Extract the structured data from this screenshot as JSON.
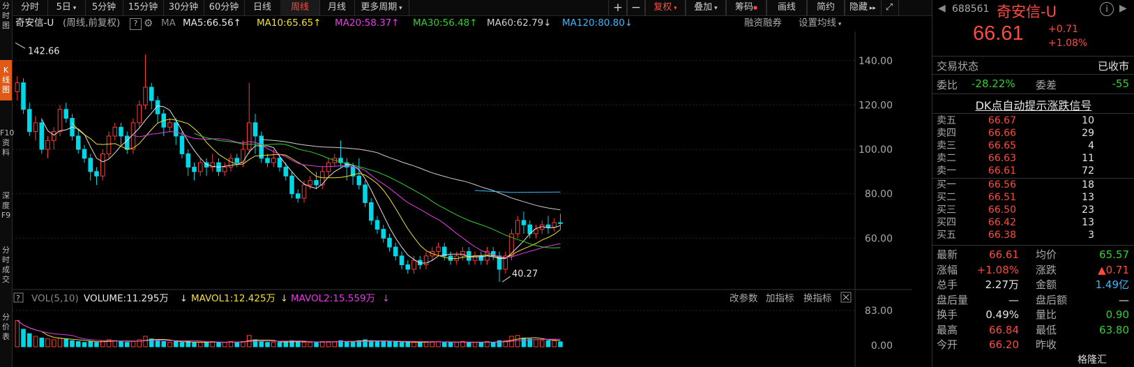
{
  "left_strip": [
    {
      "text": "分\n时\n图",
      "active": false
    },
    {
      "text": "K\n线\n图",
      "active": true
    },
    {
      "text": "F10\n资\n料",
      "active": false
    },
    {
      "text": "深\n度\nF9",
      "active": false
    },
    {
      "text": "分\n时\n成\n交",
      "active": false
    },
    {
      "text": "分\n价\n表",
      "active": false
    }
  ],
  "toolbar": {
    "periods": [
      "分时",
      "5日",
      "5分钟",
      "15分钟",
      "30分钟",
      "60分钟",
      "日线",
      "周线",
      "月线",
      "更多周期"
    ],
    "active_period": "周线",
    "right_buttons": [
      "+",
      "−",
      "复权",
      "叠加",
      "筹码",
      "画线",
      "简约",
      "隐藏"
    ]
  },
  "info": {
    "name": "奇安信-U",
    "mode": "(周线,前复权)",
    "ma_label": "MA",
    "ma": [
      {
        "text": "MA5:66.56",
        "arrow": "↑",
        "color": "#e6e6e6"
      },
      {
        "text": "MA10:65.65",
        "arrow": "↑",
        "color": "#f2e12e"
      },
      {
        "text": "MA20:58.37",
        "arrow": "↑",
        "color": "#e83ae8"
      },
      {
        "text": "MA30:56.48",
        "arrow": "↑",
        "color": "#2fd12f"
      },
      {
        "text": "MA60:62.79",
        "arrow": "↓",
        "color": "#d0d0d0"
      },
      {
        "text": "MA120:80.80",
        "arrow": "↓",
        "color": "#3ab8ff"
      }
    ],
    "right1": "融资融券",
    "right2": "设置均线"
  },
  "chart_data": {
    "type": "candlestick",
    "y_ticks": [
      "140.00",
      "120.00",
      "100.00",
      "80.00",
      "60.00"
    ],
    "ylim": [
      40,
      150
    ],
    "high_label": "142.66",
    "low_label": "40.27",
    "candles": [
      [
        126,
        130,
        122,
        133
      ],
      [
        130,
        118,
        116,
        132
      ],
      [
        118,
        108,
        106,
        121
      ],
      [
        108,
        112,
        104,
        115
      ],
      [
        112,
        100,
        98,
        114
      ],
      [
        100,
        104,
        96,
        106
      ],
      [
        104,
        108,
        100,
        110
      ],
      [
        108,
        118,
        106,
        120
      ],
      [
        118,
        114,
        112,
        121
      ],
      [
        114,
        106,
        104,
        116
      ],
      [
        106,
        100,
        98,
        109
      ],
      [
        100,
        96,
        94,
        102
      ],
      [
        96,
        90,
        86,
        98
      ],
      [
        90,
        88,
        84,
        92
      ],
      [
        88,
        98,
        86,
        100
      ],
      [
        98,
        106,
        96,
        108
      ],
      [
        106,
        110,
        104,
        112
      ],
      [
        110,
        106,
        102,
        112
      ],
      [
        106,
        100,
        98,
        108
      ],
      [
        100,
        112,
        98,
        114
      ],
      [
        112,
        120,
        110,
        122
      ],
      [
        120,
        128,
        118,
        142.66
      ],
      [
        128,
        122,
        118,
        130
      ],
      [
        122,
        116,
        112,
        124
      ],
      [
        116,
        110,
        106,
        118
      ],
      [
        110,
        112,
        108,
        114
      ],
      [
        112,
        106,
        102,
        114
      ],
      [
        106,
        98,
        96,
        108
      ],
      [
        98,
        92,
        88,
        100
      ],
      [
        92,
        90,
        86,
        94
      ],
      [
        90,
        94,
        88,
        96
      ],
      [
        94,
        92,
        88,
        96
      ],
      [
        92,
        94,
        90,
        98
      ],
      [
        94,
        90,
        88,
        96
      ],
      [
        90,
        92,
        88,
        94
      ],
      [
        92,
        96,
        90,
        98
      ],
      [
        96,
        94,
        92,
        98
      ],
      [
        94,
        100,
        92,
        104
      ],
      [
        100,
        112,
        98,
        130
      ],
      [
        112,
        106,
        98,
        116
      ],
      [
        106,
        96,
        94,
        108
      ],
      [
        96,
        94,
        92,
        98
      ],
      [
        94,
        96,
        92,
        100
      ],
      [
        96,
        92,
        90,
        98
      ],
      [
        92,
        88,
        86,
        94
      ],
      [
        88,
        80,
        78,
        90
      ],
      [
        80,
        78,
        76,
        82
      ],
      [
        78,
        84,
        76,
        86
      ],
      [
        84,
        86,
        82,
        88
      ],
      [
        86,
        84,
        82,
        90
      ],
      [
        84,
        90,
        82,
        92
      ],
      [
        90,
        94,
        88,
        96
      ],
      [
        94,
        96,
        92,
        98
      ],
      [
        96,
        94,
        92,
        104
      ],
      [
        94,
        92,
        86,
        96
      ],
      [
        92,
        88,
        84,
        94
      ],
      [
        88,
        84,
        82,
        96
      ],
      [
        84,
        76,
        74,
        86
      ],
      [
        76,
        68,
        66,
        78
      ],
      [
        68,
        64,
        62,
        70
      ],
      [
        64,
        60,
        58,
        66
      ],
      [
        60,
        56,
        54,
        62
      ],
      [
        56,
        52,
        50,
        58
      ],
      [
        52,
        48,
        46,
        54
      ],
      [
        48,
        46,
        44,
        50
      ],
      [
        46,
        50,
        44,
        52
      ],
      [
        50,
        48,
        46,
        52
      ],
      [
        48,
        52,
        46,
        54
      ],
      [
        52,
        54,
        50,
        56
      ],
      [
        54,
        56,
        52,
        58
      ],
      [
        56,
        52,
        50,
        58
      ],
      [
        52,
        50,
        48,
        54
      ],
      [
        50,
        52,
        48,
        54
      ],
      [
        52,
        54,
        50,
        56
      ],
      [
        54,
        50,
        48,
        56
      ],
      [
        50,
        52,
        48,
        54
      ],
      [
        52,
        50,
        48,
        54
      ],
      [
        50,
        54,
        48,
        56
      ],
      [
        54,
        52,
        50,
        56
      ],
      [
        52,
        46,
        40.27,
        54
      ],
      [
        46,
        52,
        44,
        54
      ],
      [
        52,
        62,
        50,
        64
      ],
      [
        62,
        68,
        60,
        70
      ],
      [
        68,
        66,
        62,
        72
      ],
      [
        66,
        62,
        60,
        68
      ],
      [
        62,
        64,
        60,
        66
      ],
      [
        64,
        66,
        62,
        68
      ],
      [
        66,
        65,
        62,
        70
      ],
      [
        65,
        67,
        63,
        69
      ],
      [
        67,
        66.61,
        63.8,
        71
      ]
    ],
    "ma_series": [
      {
        "name": "MA5",
        "color": "#e6e6e6"
      },
      {
        "name": "MA10",
        "color": "#f2e12e"
      },
      {
        "name": "MA20",
        "color": "#e83ae8"
      },
      {
        "name": "MA30",
        "color": "#2fd12f"
      },
      {
        "name": "MA60",
        "color": "#d0d0d0"
      },
      {
        "name": "MA120",
        "color": "#3ab8ff"
      }
    ],
    "volume": {
      "label": "VOL(5,10)",
      "volume_text": "VOLUME:11.295万",
      "mavol1_text": "MAVOL1:12.425万",
      "mavol2_text": "MAVOL2:15.559万",
      "ticks": [
        "83.00",
        "0.00"
      ],
      "ymax": 83,
      "values": [
        60,
        40,
        30,
        24,
        20,
        18,
        16,
        20,
        18,
        14,
        12,
        10,
        12,
        10,
        14,
        16,
        14,
        12,
        10,
        12,
        16,
        24,
        18,
        14,
        12,
        10,
        12,
        10,
        12,
        10,
        10,
        10,
        12,
        10,
        10,
        12,
        10,
        12,
        26,
        16,
        12,
        10,
        10,
        10,
        12,
        14,
        12,
        10,
        10,
        10,
        12,
        12,
        12,
        14,
        12,
        12,
        14,
        16,
        14,
        12,
        12,
        12,
        12,
        10,
        10,
        10,
        10,
        12,
        12,
        12,
        10,
        10,
        10,
        12,
        10,
        10,
        10,
        12,
        10,
        14,
        14,
        24,
        26,
        20,
        18,
        16,
        14,
        14,
        14,
        11.3
      ],
      "buttons": [
        "改参数",
        "加指标",
        "换指标"
      ]
    }
  },
  "quote": {
    "code": "688561",
    "name": "奇安信-U",
    "price": "66.61",
    "change": "+0.71",
    "change_pct": "+1.08%",
    "trade_status_label": "交易状态",
    "trade_status": "已收市",
    "wb_label": "委比",
    "wb_value": "-28.22%",
    "wc_label": "委差",
    "wc_value": "-55",
    "signal_title": "DK点自动提示涨跌信号",
    "asks": [
      {
        "label": "卖五",
        "price": "66.67",
        "vol": "10"
      },
      {
        "label": "卖四",
        "price": "66.66",
        "vol": "29"
      },
      {
        "label": "卖三",
        "price": "66.65",
        "vol": "4"
      },
      {
        "label": "卖二",
        "price": "66.63",
        "vol": "11"
      },
      {
        "label": "卖一",
        "price": "66.61",
        "vol": "72"
      }
    ],
    "bids": [
      {
        "label": "买一",
        "price": "66.56",
        "vol": "18"
      },
      {
        "label": "买二",
        "price": "66.51",
        "vol": "13"
      },
      {
        "label": "买三",
        "price": "66.50",
        "vol": "23"
      },
      {
        "label": "买四",
        "price": "66.42",
        "vol": "13"
      },
      {
        "label": "买五",
        "price": "66.38",
        "vol": "3"
      }
    ],
    "stats": [
      {
        "l1": "最新",
        "v1": "66.61",
        "c1": "red",
        "l2": "均价",
        "v2": "65.57",
        "c2": "green"
      },
      {
        "l1": "涨幅",
        "v1": "+1.08%",
        "c1": "red",
        "l2": "涨跌",
        "v2": "▲0.71",
        "c2": "red"
      },
      {
        "l1": "总手",
        "v1": "2.27万",
        "c1": "white",
        "l2": "金额",
        "v2": "1.49亿",
        "c2": "blue"
      },
      {
        "l1": "盘后量",
        "v1": "—",
        "c1": "white",
        "l2": "盘后额",
        "v2": "—",
        "c2": "white"
      },
      {
        "l1": "换手",
        "v1": "0.49%",
        "c1": "white",
        "l2": "量比",
        "v2": "0.90",
        "c2": "green"
      },
      {
        "l1": "最高",
        "v1": "66.84",
        "c1": "red",
        "l2": "最低",
        "v2": "63.80",
        "c2": "green"
      },
      {
        "l1": "今开",
        "v1": "66.20",
        "c1": "red",
        "l2": "昨收",
        "v2": "",
        "c2": "white"
      }
    ],
    "watermark": "格隆汇"
  }
}
